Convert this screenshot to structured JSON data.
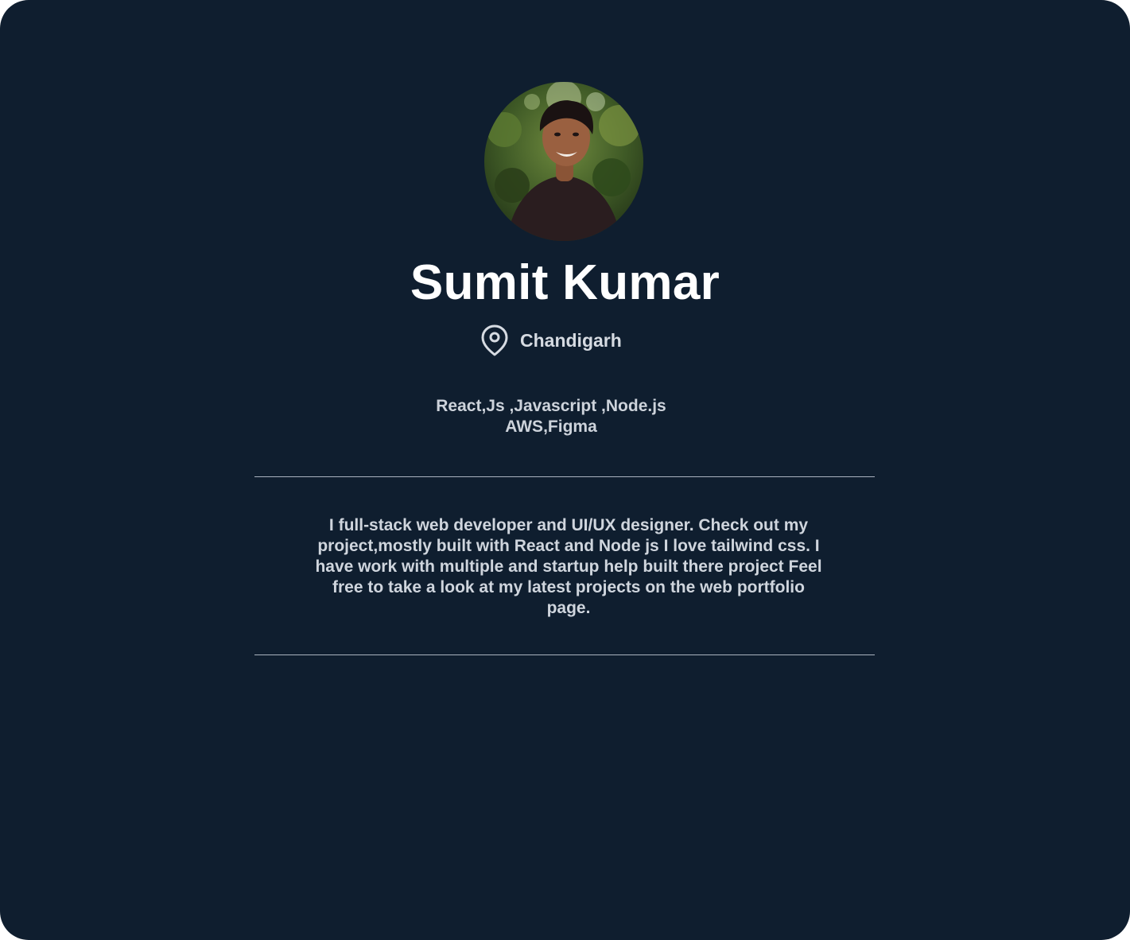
{
  "profile": {
    "name": "Sumit Kumar",
    "location": "Chandigarh",
    "skills_line1": "React,Js ,Javascript ,Node.js",
    "skills_line2": "AWS,Figma",
    "bio": "I full-stack web developer and UI/UX designer. Check out my project,mostly built with React and Node js I love tailwind css. I have work with multiple and startup help built there project Feel free to take a look at my latest projects on the web portfolio page."
  },
  "icons": {
    "location": "map-pin-icon"
  },
  "colors": {
    "background": "#0f1e2f",
    "name_text": "#ffffff",
    "body_text": "#cfd5dd",
    "divider": "#aab3bf"
  }
}
